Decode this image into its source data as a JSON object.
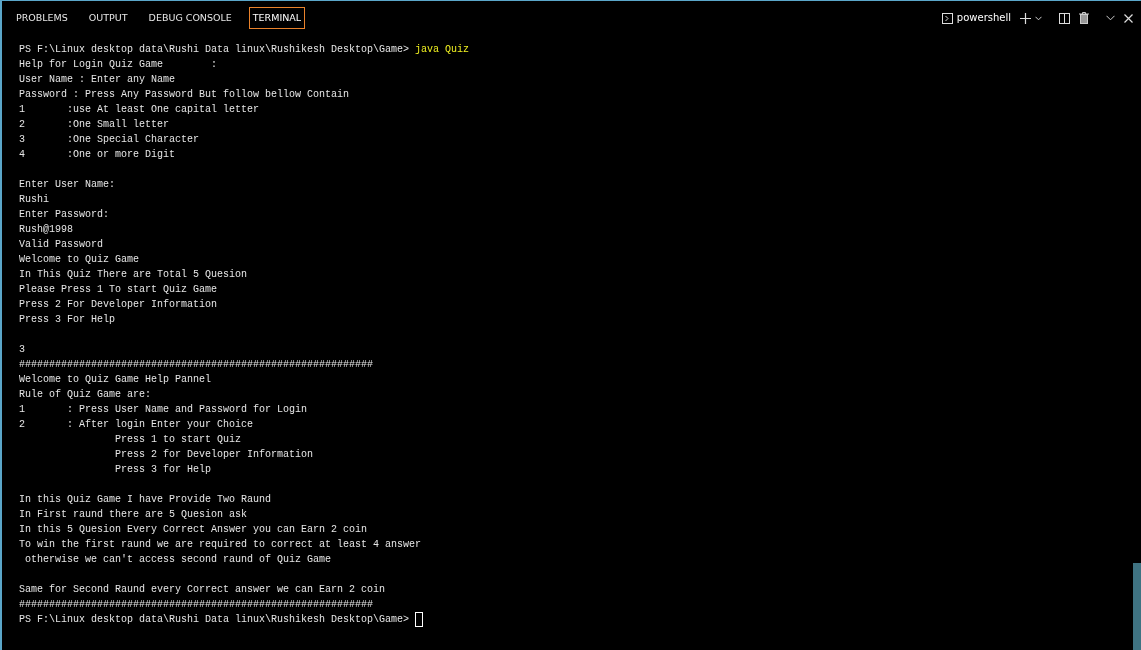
{
  "tabs": [
    {
      "label": "PROBLEMS",
      "selected": false
    },
    {
      "label": "OUTPUT",
      "selected": false
    },
    {
      "label": "DEBUG CONSOLE",
      "selected": false
    },
    {
      "label": "TERMINAL",
      "selected": true
    }
  ],
  "toolbar": {
    "shell": "powershell"
  },
  "terminal": {
    "lines": [
      {
        "kind": "prompt",
        "prompt": "PS F:\\Linux desktop data\\Rushi Data linux\\Rushikesh Desktop\\Game>",
        "command": "java Quiz",
        "cursor": false
      },
      {
        "kind": "output",
        "text": "Help for Login Quiz Game        :"
      },
      {
        "kind": "output",
        "text": "User Name : Enter any Name"
      },
      {
        "kind": "output",
        "text": "Password : Press Any Password But follow bellow Contain"
      },
      {
        "kind": "output",
        "text": "1       :use At least One capital letter"
      },
      {
        "kind": "output",
        "text": "2       :One Small letter"
      },
      {
        "kind": "output",
        "text": "3       :One Special Character"
      },
      {
        "kind": "output",
        "text": "4       :One or more Digit"
      },
      {
        "kind": "blank"
      },
      {
        "kind": "output",
        "text": "Enter User Name:"
      },
      {
        "kind": "output",
        "text": "Rushi"
      },
      {
        "kind": "output",
        "text": "Enter Password:"
      },
      {
        "kind": "output",
        "text": "Rush@1998"
      },
      {
        "kind": "output",
        "text": "Valid Password"
      },
      {
        "kind": "output",
        "text": "Welcome to Quiz Game"
      },
      {
        "kind": "output",
        "text": "In This Quiz There are Total 5 Quesion"
      },
      {
        "kind": "output",
        "text": "Please Press 1 To start Quiz Game"
      },
      {
        "kind": "output",
        "text": "Press 2 For Developer Information"
      },
      {
        "kind": "output",
        "text": "Press 3 For Help"
      },
      {
        "kind": "blank"
      },
      {
        "kind": "output",
        "text": "3"
      },
      {
        "kind": "output",
        "text": "###########################################################"
      },
      {
        "kind": "output",
        "text": "Welcome to Quiz Game Help Pannel"
      },
      {
        "kind": "output",
        "text": "Rule of Quiz Game are:"
      },
      {
        "kind": "output",
        "text": "1       : Press User Name and Password for Login"
      },
      {
        "kind": "output",
        "text": "2       : After login Enter your Choice"
      },
      {
        "kind": "output",
        "text": "                Press 1 to start Quiz"
      },
      {
        "kind": "output",
        "text": "                Press 2 for Developer Information"
      },
      {
        "kind": "output",
        "text": "                Press 3 for Help"
      },
      {
        "kind": "blank"
      },
      {
        "kind": "output",
        "text": "In this Quiz Game I have Provide Two Raund"
      },
      {
        "kind": "output",
        "text": "In First raund there are 5 Quesion ask"
      },
      {
        "kind": "output",
        "text": "In this 5 Quesion Every Correct Answer you can Earn 2 coin"
      },
      {
        "kind": "output",
        "text": "To win the first raund we are required to correct at least 4 answer"
      },
      {
        "kind": "output",
        "text": " otherwise we can't access second raund of Quiz Game"
      },
      {
        "kind": "blank"
      },
      {
        "kind": "output",
        "text": "Same for Second Raund every Correct answer we can Earn 2 coin"
      },
      {
        "kind": "output",
        "text": "###########################################################"
      },
      {
        "kind": "prompt",
        "prompt": "PS F:\\Linux desktop data\\Rushi Data linux\\Rushikesh Desktop\\Game>",
        "cursor": true
      }
    ]
  }
}
